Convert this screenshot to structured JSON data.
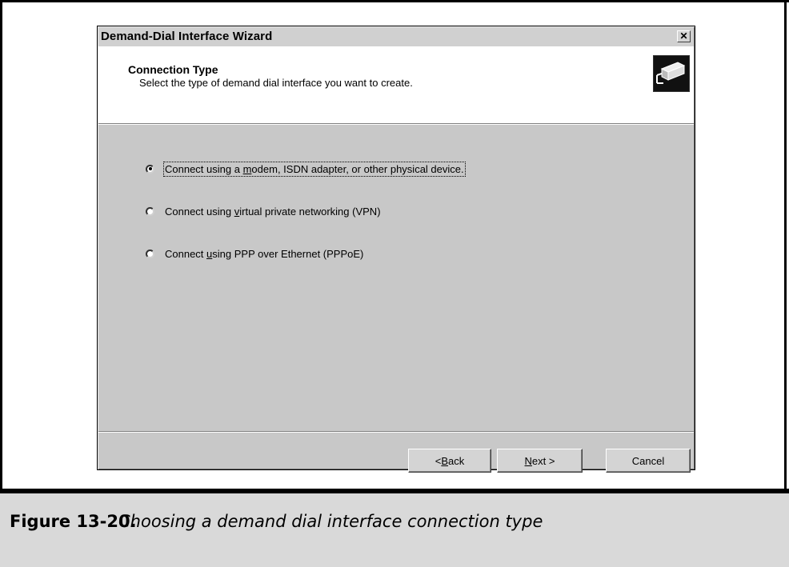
{
  "dialog": {
    "title": "Demand-Dial Interface Wizard",
    "close_label": "✕",
    "header_title": "Connection Type",
    "header_subtitle": "Select the type of demand dial interface you want to create.",
    "icon": "network-connection-icon"
  },
  "options": [
    {
      "before": "Connect using a ",
      "mnemonic": "m",
      "after": "odem, ISDN adapter, or other physical device.",
      "checked": true
    },
    {
      "before": "Connect using ",
      "mnemonic": "v",
      "after": "irtual private networking (VPN)",
      "checked": false
    },
    {
      "before": "Connect ",
      "mnemonic": "u",
      "after": "sing PPP over Ethernet (PPPoE)",
      "checked": false
    }
  ],
  "buttons": {
    "back": {
      "before": "< ",
      "mnemonic": "B",
      "after": "ack"
    },
    "next": {
      "mnemonic": "N",
      "after": "ext >"
    },
    "cancel": "Cancel"
  },
  "caption": {
    "number": "Figure 13-20.",
    "text": "Choosing a demand dial interface connection type"
  }
}
